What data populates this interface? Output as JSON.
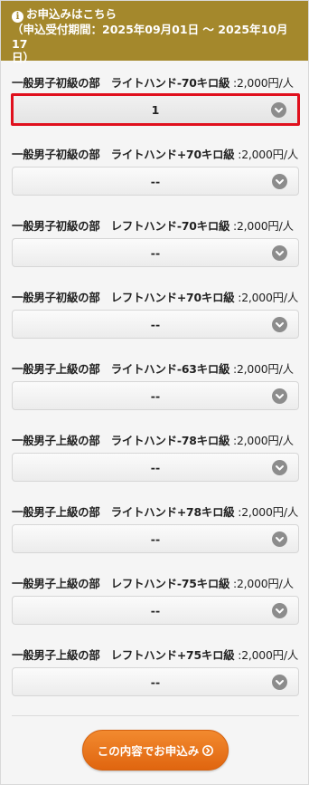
{
  "header": {
    "title": "お申込みはこちら",
    "period_line1": "（申込受付期間：2025年09月01日 〜 2025年10月17",
    "period_line2": "日）"
  },
  "rows": [
    {
      "category": "一般男子初級の部",
      "division": "ライトハンド-70キロ級",
      "price": " :2,000円/人",
      "value": "1",
      "selected": true
    },
    {
      "category": "一般男子初級の部",
      "division": "ライトハンド+70キロ級",
      "price": " :2,000円/人",
      "value": "--",
      "selected": false
    },
    {
      "category": "一般男子初級の部",
      "division": "レフトハンド-70キロ級",
      "price": " :2,000円/人",
      "value": "--",
      "selected": false
    },
    {
      "category": "一般男子初級の部",
      "division": "レフトハンド+70キロ級",
      "price": " :2,000円/人",
      "value": "--",
      "selected": false
    },
    {
      "category": "一般男子上級の部",
      "division": "ライトハンド-63キロ級",
      "price": " :2,000円/人",
      "value": "--",
      "selected": false
    },
    {
      "category": "一般男子上級の部",
      "division": "ライトハンド-78キロ級",
      "price": " :2,000円/人",
      "value": "--",
      "selected": false
    },
    {
      "category": "一般男子上級の部",
      "division": "ライトハンド+78キロ級",
      "price": " :2,000円/人",
      "value": "--",
      "selected": false
    },
    {
      "category": "一般男子上級の部",
      "division": "レフトハンド-75キロ級",
      "price": " :2,000円/人",
      "value": "--",
      "selected": false
    },
    {
      "category": "一般男子上級の部",
      "division": "レフトハンド+75キロ級",
      "price": " :2,000円/人",
      "value": "--",
      "selected": false
    }
  ],
  "submit": {
    "label": "この内容でお申込み"
  },
  "colors": {
    "header": "#a4882c",
    "button": "#e8731c",
    "highlight": "#e0101d"
  },
  "icons": {
    "header": "info-icon",
    "select": "chevron-down-icon",
    "submit": "arrow-right-circle-icon"
  }
}
